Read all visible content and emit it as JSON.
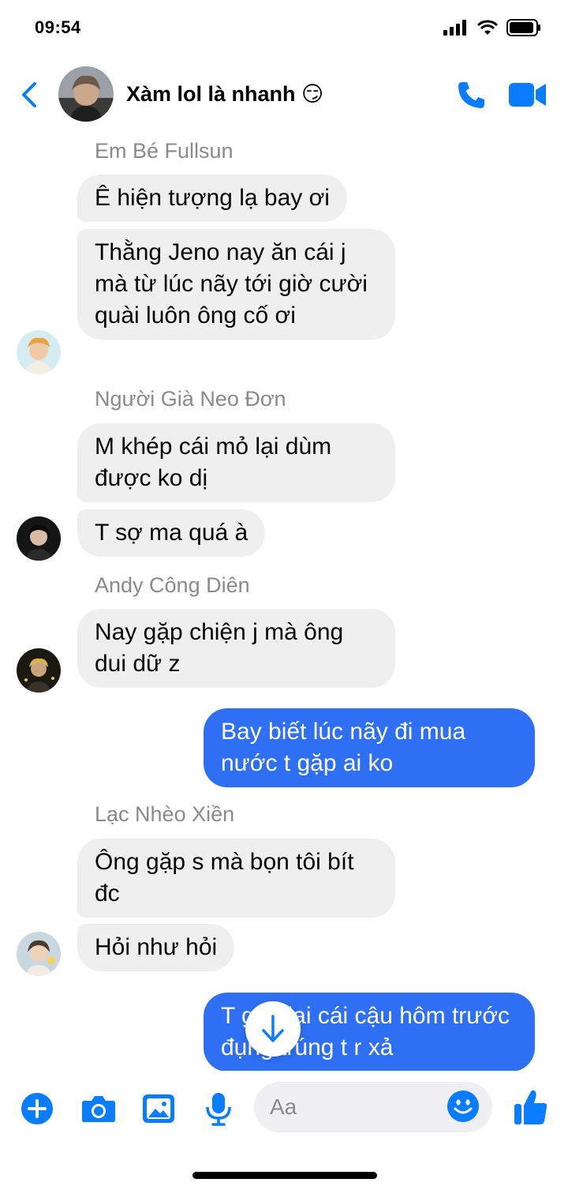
{
  "status_bar": {
    "time": "09:54"
  },
  "header": {
    "title": "Xàm lol là nhanh 😏"
  },
  "messages": {
    "m1": {
      "sender": "Em Bé Fullsun",
      "b1": "Ê hiện tượng lạ bay ơi",
      "b2": "Thằng Jeno nay ăn cái j mà từ lúc nãy tới giờ cười quài luôn ông cố ơi"
    },
    "m2": {
      "sender": "Người Già Neo Đơn",
      "b1": "M khép cái mỏ lại dùm được ko dị",
      "b2": "T sợ ma quá à"
    },
    "m3": {
      "sender": "Andy Công Diên",
      "b1": "Nay gặp chiện j mà ông dui dữ z"
    },
    "m4": {
      "b1": "Bay biết lúc nãy đi mua nước t gặp ai ko"
    },
    "m5": {
      "sender": "Lạc Nhèo Xiền",
      "b1": "Ông gặp s mà bọn tôi bít đc",
      "b2": "Hỏi như hỏi"
    },
    "m6": {
      "b1": "T gặp lại cái cậu hôm trước đụng trúng t r xả"
    }
  },
  "composer": {
    "placeholder": "Aa"
  },
  "icons": {
    "back": "chevron-left-icon",
    "call": "phone-icon",
    "video": "video-camera-icon",
    "add": "plus-circle-icon",
    "camera": "camera-icon",
    "gallery": "image-icon",
    "mic": "microphone-icon",
    "emoji": "smiley-icon",
    "like": "thumbs-up-icon",
    "scroll": "arrow-down-icon"
  },
  "colors": {
    "accent": "#0a7cff",
    "outgoing_bubble": "#2e6ff3",
    "incoming_bubble": "#efeff0",
    "secondary_text": "#8a8a8e"
  }
}
